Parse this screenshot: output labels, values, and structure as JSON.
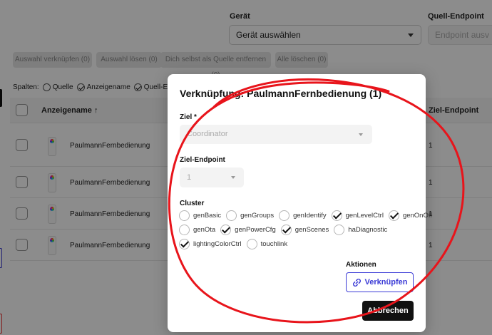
{
  "header": {
    "device_label": "Gerät",
    "device_select": "Gerät auswählen",
    "source_endpoint_label": "Quell-Endpoint",
    "source_endpoint_select": "Endpoint ausv"
  },
  "toolbar": {
    "link_selection": "Auswahl verknüpfen (0)",
    "unlink_selection": "Auswahl lösen (0)",
    "remove_self_source": "Dich selbst als Quelle entfernen (0)",
    "delete_all": "Alle löschen (0)"
  },
  "columns_bar": {
    "label": "Spalten:",
    "options": [
      "Quelle",
      "Anzeigename",
      "Quell-Endpo"
    ]
  },
  "table": {
    "headers": {
      "name": "Anzeigename ↑",
      "source_endpoint": "Ziel-Endpoint"
    },
    "rows": [
      {
        "name": "PaulmannFernbedienung",
        "endpoint": "1"
      },
      {
        "name": "PaulmannFernbedienung",
        "endpoint": "1"
      },
      {
        "name": "PaulmannFernbedienung",
        "endpoint": "1"
      },
      {
        "name": "PaulmannFernbedienung",
        "endpoint": "1"
      }
    ]
  },
  "modal": {
    "title": "Verknüpfung: PaulmannFernbedienung (1)",
    "target_label": "Ziel *",
    "target_value": "Coordinator",
    "target_endpoint_label": "Ziel-Endpoint",
    "target_endpoint_value": "1",
    "cluster_label": "Cluster",
    "clusters": [
      {
        "name": "genBasic",
        "checked": false
      },
      {
        "name": "genGroups",
        "checked": false
      },
      {
        "name": "genIdentify",
        "checked": false
      },
      {
        "name": "genLevelCtrl",
        "checked": true
      },
      {
        "name": "genOnOff",
        "checked": true
      },
      {
        "name": "genOta",
        "checked": false
      },
      {
        "name": "genPowerCfg",
        "checked": true
      },
      {
        "name": "genScenes",
        "checked": true
      },
      {
        "name": "haDiagnostic",
        "checked": false
      },
      {
        "name": "lightingColorCtrl",
        "checked": true
      },
      {
        "name": "touchlink",
        "checked": false
      }
    ],
    "actions_label": "Aktionen",
    "link_button": "Verknüpfen",
    "cancel_button": "Abbrechen"
  },
  "colors": {
    "accent": "#3b3bd6",
    "annotation": "#e8141b",
    "overlay": "rgba(0,0,0,0.45)"
  },
  "icons": [
    "link-icon",
    "chevron-down-icon",
    "remote-device-icon"
  ]
}
